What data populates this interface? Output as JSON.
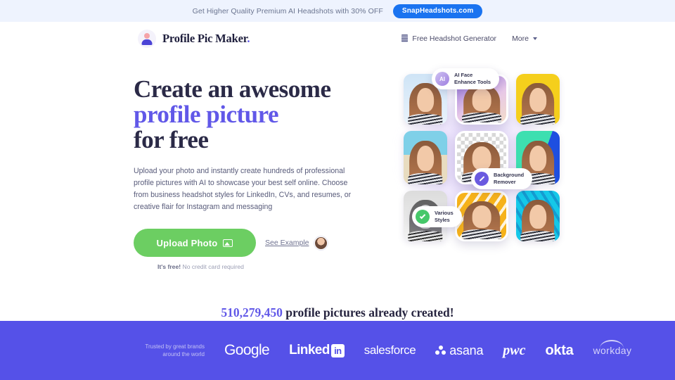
{
  "promo": {
    "text": "Get Higher Quality Premium AI Headshots with 30% OFF",
    "button_label": "SnapHeadshots.com",
    "button_color": "#1a73f0",
    "background": "#eef3fe"
  },
  "header": {
    "brand_name": "Profile Pic Maker",
    "brand_dot": ".",
    "nav": [
      {
        "label": "Free Headshot Generator",
        "icon": "stripes-icon"
      },
      {
        "label": "More",
        "icon": "chevron-down-icon"
      }
    ]
  },
  "hero": {
    "headline_line1": "Create an awesome",
    "headline_accent": "profile picture",
    "headline_line3": "for free",
    "accent_color": "#6158e8",
    "paragraph": "Upload your photo and instantly create hundreds of professional profile pictures with AI to showcase your best self online. Choose from business headshot styles for LinkedIn, CVs, and resumes, or creative flair for Instagram and messaging",
    "upload_label": "Upload Photo",
    "upload_color": "#6cce62",
    "see_example_label": "See Example",
    "free_note_bold": "It's free!",
    "free_note_rest": " No credit card required",
    "badges": [
      {
        "label": "AI Face\nEnhance Tools",
        "icon_text": "AI",
        "icon": "ai-circle-icon"
      },
      {
        "label": "Background\nRemover",
        "icon_text": "",
        "icon": "wand-icon"
      },
      {
        "label": "Various\nStyles",
        "icon_text": "",
        "icon": "check-icon"
      }
    ],
    "tiles": [
      {
        "style": "bg-blue",
        "name": "portrait-blue"
      },
      {
        "style": "bg-purple",
        "name": "portrait-purple"
      },
      {
        "style": "bg-yellow",
        "name": "portrait-yellow"
      },
      {
        "style": "bg-beach",
        "name": "portrait-beach"
      },
      {
        "style": "bg-checker",
        "name": "portrait-transparent"
      },
      {
        "style": "bg-teal",
        "name": "portrait-teal"
      },
      {
        "style": "bg-gray",
        "name": "portrait-grayscale"
      },
      {
        "style": "bg-pattern",
        "name": "portrait-pattern"
      },
      {
        "style": "bg-cyan",
        "name": "portrait-cyan"
      }
    ]
  },
  "counter": {
    "number": "510,279,450",
    "suffix": " profile pictures already created!"
  },
  "brands": {
    "trusted_text": "Trusted by great brands around the world",
    "background": "#5551e8",
    "logos": [
      {
        "name": "google",
        "text": "Google"
      },
      {
        "name": "linkedin",
        "text": "Linked",
        "badge": "in"
      },
      {
        "name": "salesforce",
        "text": "salesforce"
      },
      {
        "name": "asana",
        "text": "asana"
      },
      {
        "name": "pwc",
        "text": "pwc"
      },
      {
        "name": "okta",
        "text": "okta"
      },
      {
        "name": "workday",
        "text": "workday"
      }
    ]
  }
}
